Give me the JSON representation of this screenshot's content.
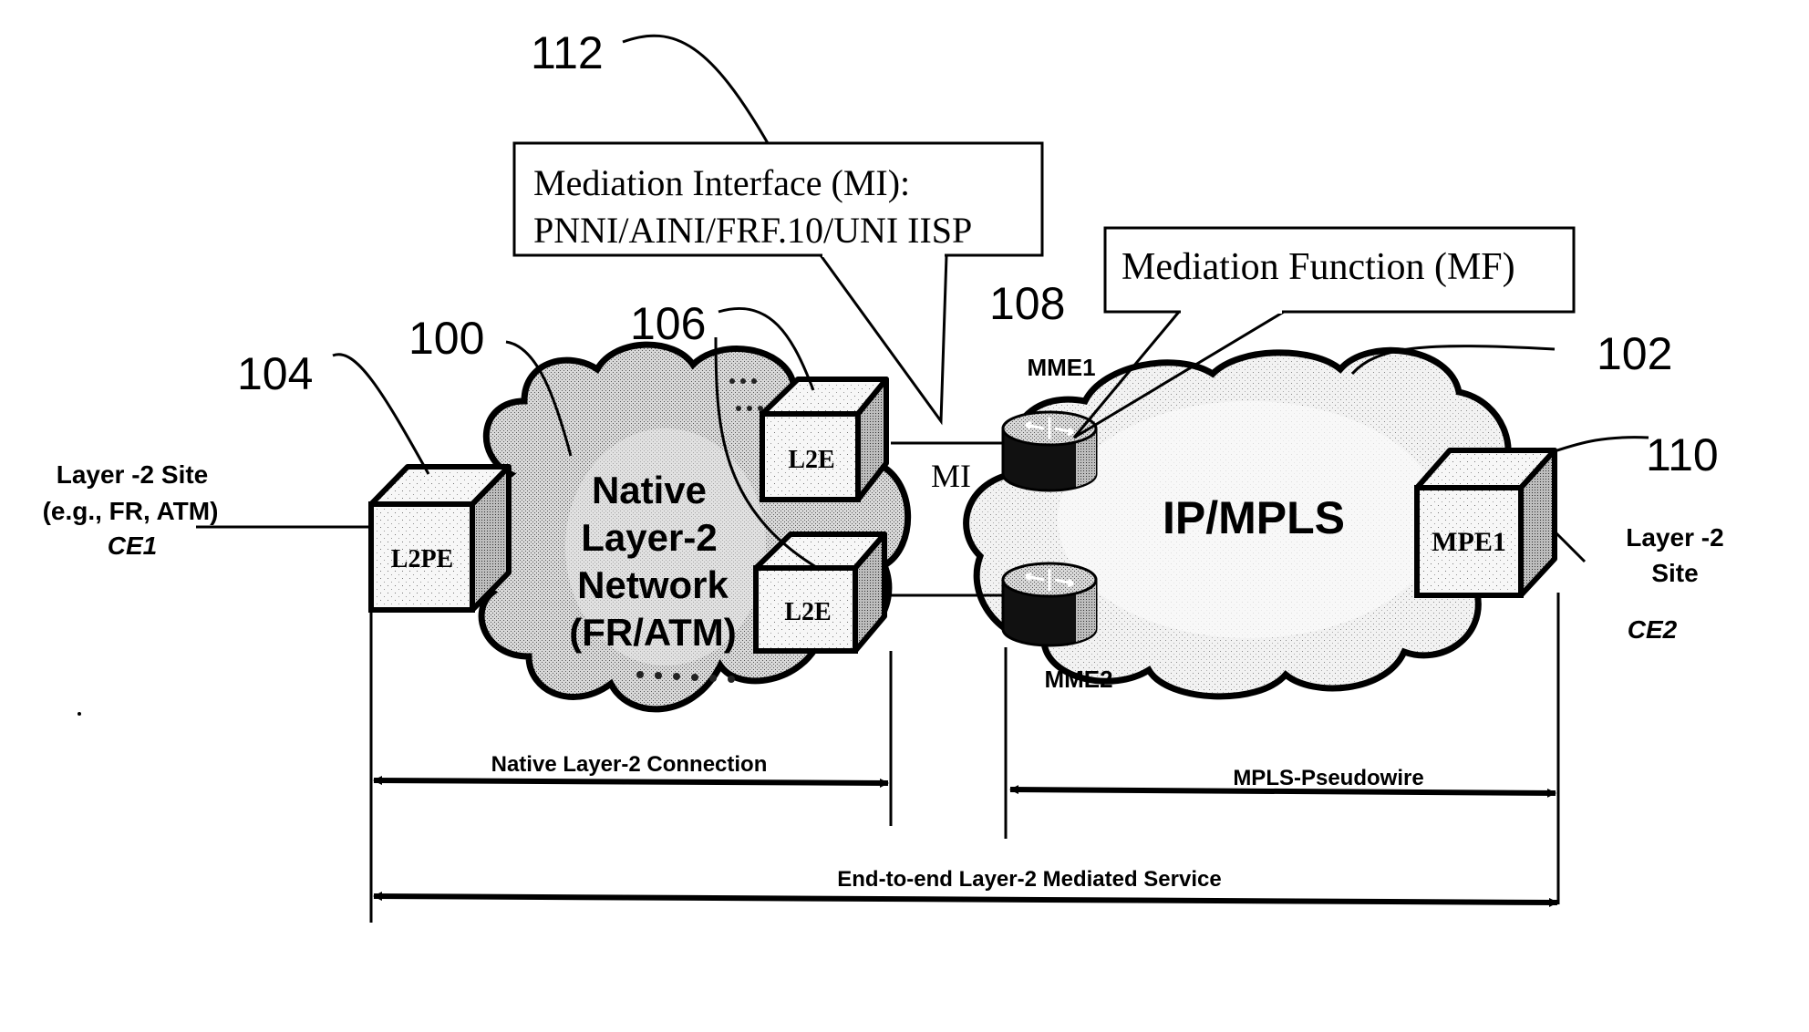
{
  "diagram": {
    "reference_numerals": {
      "n112": "112",
      "n100": "100",
      "n104": "104",
      "n106": "106",
      "n108": "108",
      "n102": "102",
      "n110": "110"
    },
    "callouts": {
      "mediation_interface": {
        "line1": "Mediation Interface (MI):",
        "line2": "PNNI/AINI/FRF.10/UNI IISP"
      },
      "mediation_function": "Mediation Function (MF)"
    },
    "left_network": {
      "line1": "Native",
      "line2": "Layer-2",
      "line3": "Network",
      "line4": "(FR/ATM)"
    },
    "right_network": {
      "label": "IP/MPLS"
    },
    "nodes": {
      "l2pe": "L2PE",
      "l2e_top": "L2E",
      "l2e_bottom": "L2E",
      "mpe1": "MPE1",
      "mme1": "MME1",
      "mme2": "MME2"
    },
    "interface_label": "MI",
    "sites": {
      "ce1": {
        "line1": "Layer -2 Site",
        "line2": "(e.g., FR, ATM)",
        "name": "CE1"
      },
      "ce2": {
        "line1": "Layer -2",
        "line2": "Site",
        "name": "CE2"
      }
    },
    "spans": {
      "native": "Native Layer-2 Connection",
      "pseudowire": "MPLS-Pseudowire",
      "end_to_end": "End-to-end Layer-2 Mediated Service"
    }
  }
}
